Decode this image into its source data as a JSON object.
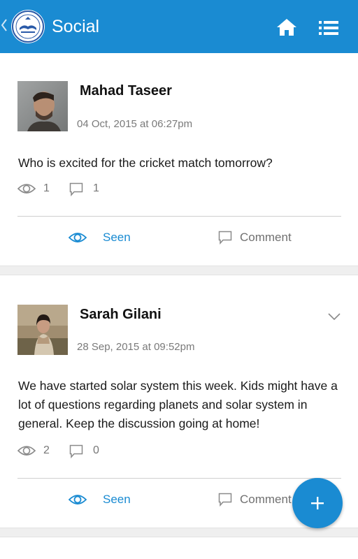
{
  "header": {
    "title": "Social",
    "back_icon": "chevron-left-icon",
    "logo_icon": "school-logo",
    "home_icon": "home-icon",
    "menu_icon": "list-menu-icon",
    "color": "#1a8bd2"
  },
  "posts": [
    {
      "author": "Mahad Taseer",
      "timestamp": "04 Oct, 2015 at 06:27pm",
      "text": "Who is excited for the cricket match tomorrow?",
      "views": "1",
      "comments": "1",
      "seen_label": "Seen",
      "comment_label": "Comment"
    },
    {
      "author": "Sarah Gilani",
      "timestamp": "28 Sep, 2015 at 09:52pm",
      "text": "We have started solar system this week. Kids might have a lot of questions regarding planets and solar system in general. Keep the discussion going at home!",
      "views": "2",
      "comments": "0",
      "seen_label": "Seen",
      "comment_label": "Comment"
    }
  ],
  "fab": {
    "icon": "plus-icon"
  }
}
